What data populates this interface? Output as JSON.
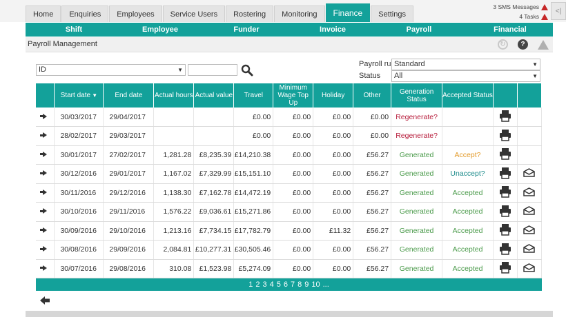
{
  "tabs": [
    "Home",
    "Enquiries",
    "Employees",
    "Service Users",
    "Rostering",
    "Monitoring",
    "Finance",
    "Settings"
  ],
  "active_tab": "Finance",
  "notifications": {
    "sms": "3 SMS Messages",
    "tasks": "4 Tasks"
  },
  "subnav": [
    "Shift",
    "Employee",
    "Funder",
    "Invoice",
    "Payroll",
    "Financial"
  ],
  "section_title": "Payroll Management",
  "filters": {
    "field": "ID",
    "payroll_run_label": "Payroll run",
    "payroll_run_value": "Standard",
    "status_label": "Status",
    "status_value": "All"
  },
  "columns": [
    "",
    "Start date",
    "End date",
    "Actual hours",
    "Actual value",
    "Travel",
    "Minimum Wage Top Up",
    "Holiday",
    "Other",
    "Generation Status",
    "Accepted Status",
    "",
    ""
  ],
  "rows": [
    {
      "start": "30/03/2017",
      "end": "29/04/2017",
      "hours": "",
      "value": "",
      "travel": "£0.00",
      "min_wage": "£0.00",
      "holiday": "£0.00",
      "other": "£0.00",
      "gen": "Regenerate?",
      "acc": "",
      "email": false
    },
    {
      "start": "28/02/2017",
      "end": "29/03/2017",
      "hours": "",
      "value": "",
      "travel": "£0.00",
      "min_wage": "£0.00",
      "holiday": "£0.00",
      "other": "£0.00",
      "gen": "Regenerate?",
      "acc": "",
      "email": false
    },
    {
      "start": "30/01/2017",
      "end": "27/02/2017",
      "hours": "1,281.28",
      "value": "£8,235.39",
      "travel": "£14,210.38",
      "min_wage": "£0.00",
      "holiday": "£0.00",
      "other": "£56.27",
      "gen": "Generated",
      "acc": "Accept?",
      "email": false
    },
    {
      "start": "30/12/2016",
      "end": "29/01/2017",
      "hours": "1,167.02",
      "value": "£7,329.99",
      "travel": "£15,151.10",
      "min_wage": "£0.00",
      "holiday": "£0.00",
      "other": "£56.27",
      "gen": "Generated",
      "acc": "Unaccept?",
      "email": true
    },
    {
      "start": "30/11/2016",
      "end": "29/12/2016",
      "hours": "1,138.30",
      "value": "£7,162.78",
      "travel": "£14,472.19",
      "min_wage": "£0.00",
      "holiday": "£0.00",
      "other": "£56.27",
      "gen": "Generated",
      "acc": "Accepted",
      "email": true
    },
    {
      "start": "30/10/2016",
      "end": "29/11/2016",
      "hours": "1,576.22",
      "value": "£9,036.61",
      "travel": "£15,271.86",
      "min_wage": "£0.00",
      "holiday": "£0.00",
      "other": "£56.27",
      "gen": "Generated",
      "acc": "Accepted",
      "email": true
    },
    {
      "start": "30/09/2016",
      "end": "29/10/2016",
      "hours": "1,213.16",
      "value": "£7,734.15",
      "travel": "£17,782.79",
      "min_wage": "£0.00",
      "holiday": "£11.32",
      "other": "£56.27",
      "gen": "Generated",
      "acc": "Accepted",
      "email": true
    },
    {
      "start": "30/08/2016",
      "end": "29/09/2016",
      "hours": "2,084.81",
      "value": "£10,277.31",
      "travel": "£30,505.46",
      "min_wage": "£0.00",
      "holiday": "£0.00",
      "other": "£56.27",
      "gen": "Generated",
      "acc": "Accepted",
      "email": true
    },
    {
      "start": "30/07/2016",
      "end": "29/08/2016",
      "hours": "310.08",
      "value": "£1,523.98",
      "travel": "£5,274.09",
      "min_wage": "£0.00",
      "holiday": "£0.00",
      "other": "£56.27",
      "gen": "Generated",
      "acc": "Accepted",
      "email": true
    }
  ],
  "pages": [
    "1",
    "2",
    "3",
    "4",
    "5",
    "6",
    "7",
    "8",
    "9",
    "10",
    "..."
  ],
  "colors": {
    "accent": "#13a19a",
    "regen": "#b71c3b",
    "generated": "#4a9a4a",
    "accept": "#e39a28"
  }
}
